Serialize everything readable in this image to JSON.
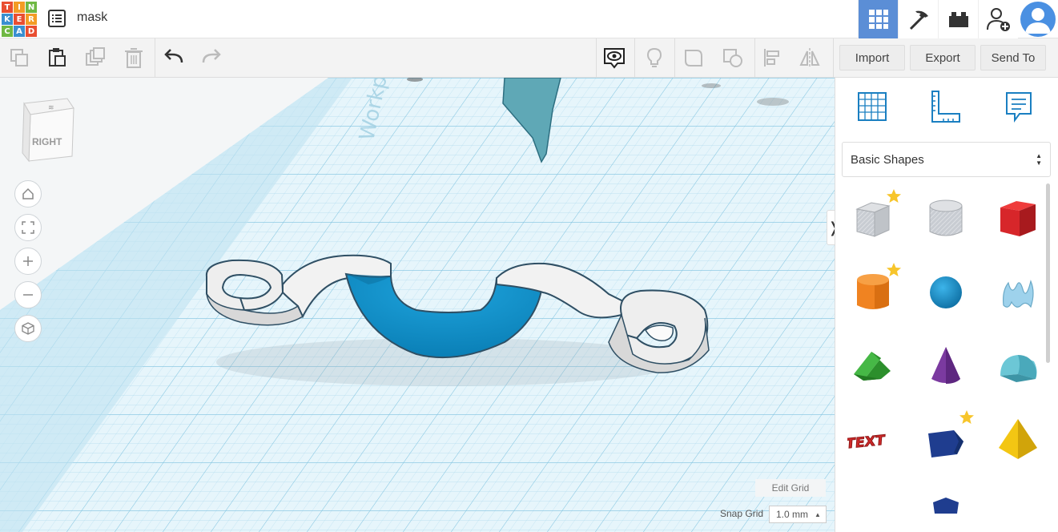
{
  "app": {
    "logo_letters": [
      "T",
      "I",
      "N",
      "K",
      "E",
      "R",
      "C",
      "A",
      "D"
    ],
    "logo_colors": [
      "#e94e31",
      "#f39c25",
      "#6fb843",
      "#3a8fd0",
      "#e94e31",
      "#f39c25",
      "#6fb843",
      "#3a8fd0",
      "#e94e31"
    ],
    "design_title": "mask",
    "accent": "#5b8ed6"
  },
  "topbar": {
    "icons": [
      "grid-view-icon",
      "pickaxe-icon",
      "bricks-icon",
      "add-user-icon",
      "avatar"
    ]
  },
  "toolbar": {
    "icons": [
      "copy-icon",
      "paste-icon",
      "duplicate-icon",
      "delete-icon",
      "undo-icon",
      "redo-icon",
      "show-all-icon",
      "light-bulb-icon",
      "group-icon",
      "ungroup-icon",
      "align-icon",
      "mirror-icon"
    ],
    "import_label": "Import",
    "export_label": "Export",
    "send_to_label": "Send To"
  },
  "viewport": {
    "view_cube_label": "RIGHT",
    "nav_icons": [
      "home-icon",
      "fit-view-icon",
      "zoom-in-icon",
      "zoom-out-icon",
      "perspective-icon"
    ],
    "edit_grid_label": "Edit Grid",
    "snap_grid_label": "Snap Grid",
    "snap_grid_value": "1.0 mm",
    "collapse_symbol": "❭",
    "workplane_text": "Workplane"
  },
  "panel": {
    "tabs": [
      "workplane-icon",
      "ruler-icon",
      "notes-icon"
    ],
    "shape_category": "Basic Shapes",
    "shapes": [
      {
        "name": "box-hole",
        "star": true
      },
      {
        "name": "cylinder-hole",
        "star": false
      },
      {
        "name": "box",
        "star": false
      },
      {
        "name": "cylinder",
        "star": true
      },
      {
        "name": "sphere",
        "star": false
      },
      {
        "name": "scribble",
        "star": false
      },
      {
        "name": "roof",
        "star": false
      },
      {
        "name": "cone",
        "star": false
      },
      {
        "name": "round-roof",
        "star": false
      },
      {
        "name": "text",
        "star": false
      },
      {
        "name": "polygon",
        "star": true
      },
      {
        "name": "pyramid",
        "star": false
      }
    ],
    "shape_colors": {
      "box": "#d7262a",
      "cylinder": "#f08321",
      "sphere": "#1a8fd1",
      "roof": "#3aa03a",
      "cone": "#7b3aa0",
      "round-roof": "#5bbccc",
      "text": "#d02a2a",
      "polygon": "#1f3d8f",
      "pyramid": "#f3c613",
      "hole": "#c8ccd2",
      "star": "#f7c52b"
    },
    "text_shape_label": "TEXT"
  }
}
